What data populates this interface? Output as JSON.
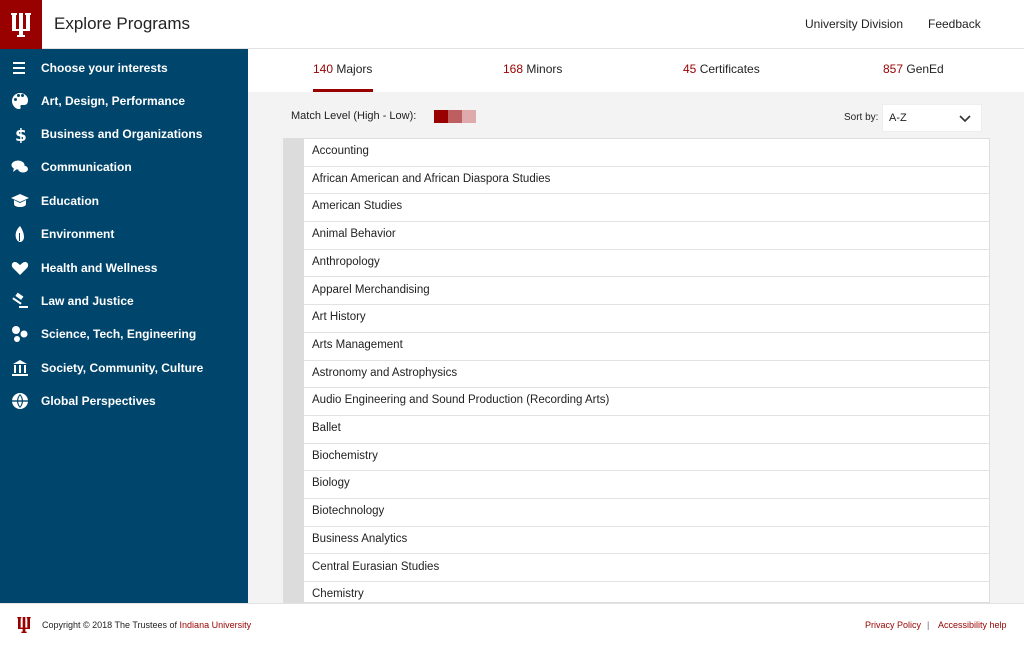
{
  "header": {
    "title": "Explore Programs",
    "links": [
      "University Division",
      "Feedback"
    ]
  },
  "sidebar": {
    "items": [
      {
        "label": "Choose your interests",
        "icon": "menu-icon"
      },
      {
        "label": "Art, Design, Performance",
        "icon": "palette-icon"
      },
      {
        "label": "Business and Organizations",
        "icon": "dollar-icon"
      },
      {
        "label": "Communication",
        "icon": "speech-bubbles-icon"
      },
      {
        "label": "Education",
        "icon": "graduation-cap-icon"
      },
      {
        "label": "Environment",
        "icon": "leaf-icon"
      },
      {
        "label": "Health and Wellness",
        "icon": "heart-icon"
      },
      {
        "label": "Law and Justice",
        "icon": "gavel-icon"
      },
      {
        "label": "Science, Tech, Engineering",
        "icon": "molecule-icon"
      },
      {
        "label": "Society, Community, Culture",
        "icon": "building-icon"
      },
      {
        "label": "Global Perspectives",
        "icon": "globe-icon"
      }
    ]
  },
  "tabs": [
    {
      "count": "140",
      "label": "Majors",
      "active": true
    },
    {
      "count": "168",
      "label": "Minors",
      "active": false
    },
    {
      "count": "45",
      "label": "Certificates",
      "active": false
    },
    {
      "count": "857",
      "label": "GenEd",
      "active": false
    }
  ],
  "toolbar": {
    "match_label": "Match Level (High - Low):",
    "match_colors": [
      "#990000",
      "#bd5e60",
      "#dfaaab"
    ],
    "sort_label": "Sort by:",
    "sort_value": "A-Z"
  },
  "programs": [
    "Accounting",
    "African American and African Diaspora Studies",
    "American Studies",
    "Animal Behavior",
    "Anthropology",
    "Apparel Merchandising",
    "Art History",
    "Arts Management",
    "Astronomy and Astrophysics",
    "Audio Engineering and Sound Production (Recording Arts)",
    "Ballet",
    "Biochemistry",
    "Biology",
    "Biotechnology",
    "Business Analytics",
    "Central Eurasian Studies",
    "Chemistry"
  ],
  "footer": {
    "copyright_prefix": "Copyright © 2018 The Trustees of ",
    "copyright_org": "Indiana University",
    "privacy": "Privacy Policy",
    "separator": "|",
    "accessibility": "Accessibility help"
  },
  "colors": {
    "brand": "#990000",
    "sidebar": "#00456c"
  }
}
